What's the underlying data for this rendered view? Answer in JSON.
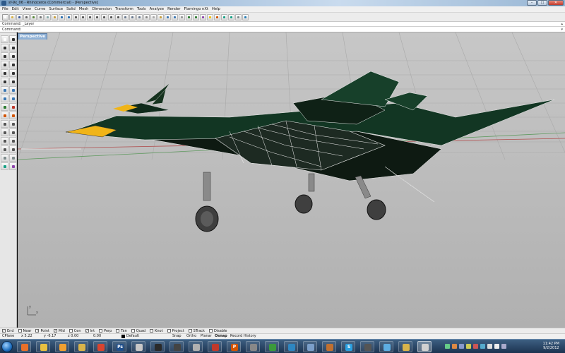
{
  "titlebar": {
    "title": "sf-9x_06 - Rhinoceros (Commercial) - [Perspective]",
    "buttons": {
      "minimize": "–",
      "maximize": "□",
      "close": "✕"
    }
  },
  "menubar": [
    "File",
    "Edit",
    "View",
    "Curve",
    "Surface",
    "Solid",
    "Mesh",
    "Dimension",
    "Transform",
    "Tools",
    "Analyze",
    "Render",
    "Flamingo nXt",
    "Help"
  ],
  "command": {
    "history": "Command: _Layer",
    "prompt": "Command:"
  },
  "viewport": {
    "title": "Perspective",
    "axis_labels": {
      "y": "y",
      "x": "x"
    }
  },
  "osnaps": [
    {
      "label": "End",
      "checked": true
    },
    {
      "label": "Near",
      "checked": false
    },
    {
      "label": "Point",
      "checked": true
    },
    {
      "label": "Mid",
      "checked": true
    },
    {
      "label": "Cen",
      "checked": false
    },
    {
      "label": "Int",
      "checked": true
    },
    {
      "label": "Perp",
      "checked": false
    },
    {
      "label": "Tan",
      "checked": false
    },
    {
      "label": "Quad",
      "checked": false
    },
    {
      "label": "Knot",
      "checked": false
    },
    {
      "label": "Project",
      "checked": false
    },
    {
      "label": "STrack",
      "checked": false
    },
    {
      "label": "Disable",
      "checked": false
    }
  ],
  "statusbar": {
    "cplane": "CPlane",
    "x": "x 5.22",
    "y": "y -6.17",
    "z": "z 0.00",
    "extra": "0.00",
    "layer": "Default",
    "snap": "Snap",
    "ortho": "Ortho",
    "planar": "Planar",
    "osnap": "Osnap",
    "record_history": "Record History"
  },
  "taskbar": {
    "apps": [
      {
        "icon": "firefox-icon",
        "color": "#e8702a"
      },
      {
        "icon": "explorer-icon",
        "color": "#e8c040"
      },
      {
        "icon": "media-player-icon",
        "color": "#f0a030"
      },
      {
        "icon": "folder-icon",
        "color": "#d9b44a"
      },
      {
        "icon": "chrome-icon",
        "color": "#d9442f"
      },
      {
        "icon": "photoshop-icon",
        "color": "#1f4f8c",
        "label": "Ps"
      },
      {
        "icon": "rhino-icon",
        "color": "#c7c7c7"
      },
      {
        "icon": "steam-icon",
        "color": "#2a2a2a"
      },
      {
        "icon": "zbrush-icon",
        "color": "#444"
      },
      {
        "icon": "camera-icon",
        "color": "#b0b0b0"
      },
      {
        "icon": "adobe-icon",
        "color": "#c0392b"
      },
      {
        "icon": "powerpoint-icon",
        "color": "#d35400",
        "label": "P"
      },
      {
        "icon": "settings-icon",
        "color": "#888"
      },
      {
        "icon": "chrome-icon",
        "color": "#3b9a3b"
      },
      {
        "icon": "globe-icon",
        "color": "#2e86c1"
      },
      {
        "icon": "app-icon",
        "color": "#7b9fc9"
      },
      {
        "icon": "paint-icon",
        "color": "#c07030"
      },
      {
        "icon": "skype-icon",
        "color": "#2ba0e0",
        "label": "S"
      },
      {
        "icon": "grid-icon",
        "color": "#555"
      },
      {
        "icon": "eye-icon",
        "color": "#5dade2"
      },
      {
        "icon": "folder-icon",
        "color": "#d9b44a"
      },
      {
        "icon": "rhino-icon",
        "color": "#d0d0d0",
        "active": true
      }
    ],
    "time": "11:42 PM",
    "date": "9/2/2012"
  }
}
